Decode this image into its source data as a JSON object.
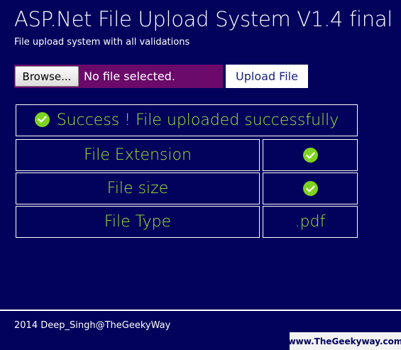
{
  "header": {
    "title": "ASP.Net File Upload System V1.4 final",
    "subtitle": "File upload system with all validations"
  },
  "upload": {
    "browse_label": "Browse...",
    "file_status": "No file selected.",
    "upload_label": "Upload File"
  },
  "results": {
    "success_icon": "check-circle-icon",
    "success_message": "Success ! File uploaded successfully",
    "rows": [
      {
        "label": "File Extension",
        "value": "",
        "icon": "check-circle-icon"
      },
      {
        "label": "File size",
        "value": "",
        "icon": "check-circle-icon"
      },
      {
        "label": "File Type",
        "value": ".pdf"
      }
    ]
  },
  "footer": {
    "copyright": "2014 Deep_Singh@TheGeekyWay",
    "watermark": "www.TheGeekyway.com"
  },
  "colors": {
    "background": "#02025c",
    "file_input": "#6b0a6b",
    "result_text": "#a4e831",
    "check": "#7ed321"
  }
}
